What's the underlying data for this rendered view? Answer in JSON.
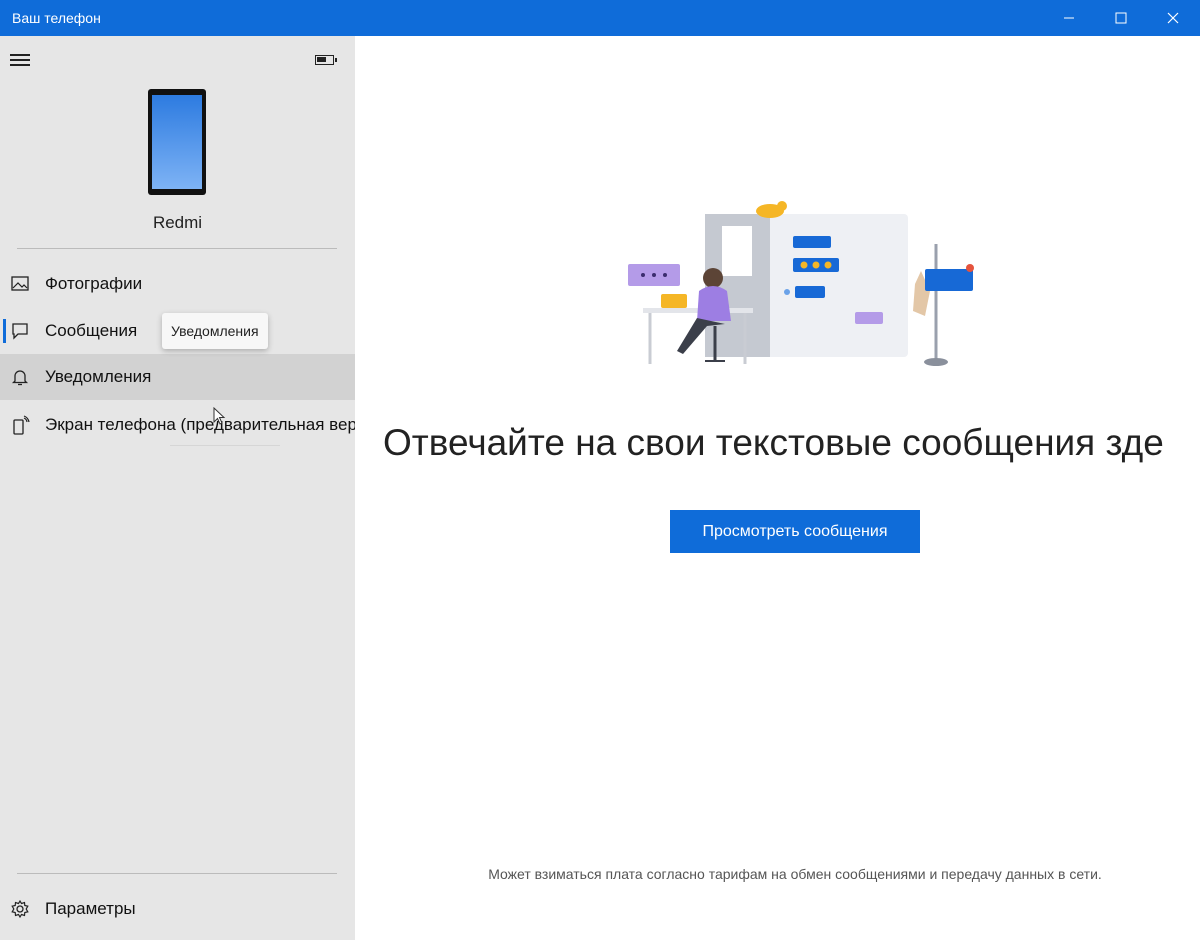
{
  "window": {
    "title": "Ваш телефон",
    "controls": {
      "minimize_icon": "minimize-icon",
      "maximize_icon": "maximize-icon",
      "close_icon": "close-icon"
    }
  },
  "sidebar": {
    "device_name": "Redmi",
    "battery_level": 0.5,
    "items": [
      {
        "label": "Фотографии",
        "icon": "photos-icon"
      },
      {
        "label": "Сообщения",
        "icon": "messages-icon",
        "selected": true
      },
      {
        "label": "Уведомления",
        "icon": "bell-icon",
        "hovered": true
      },
      {
        "label": "Экран телефона (предварительная верси",
        "icon": "phone-screen-icon"
      }
    ],
    "tooltip": "Уведомления",
    "settings_label": "Параметры"
  },
  "main": {
    "headline": "Отвечайте на свои текстовые сообщения зде",
    "cta_label": "Просмотреть сообщения",
    "disclaimer": "Может взиматься плата согласно тарифам на обмен сообщениями и передачу данных в сети."
  },
  "colors": {
    "accent": "#0f6cd9",
    "sidebar_bg": "#e6e6e6",
    "hover_bg": "#d2d2d2"
  }
}
